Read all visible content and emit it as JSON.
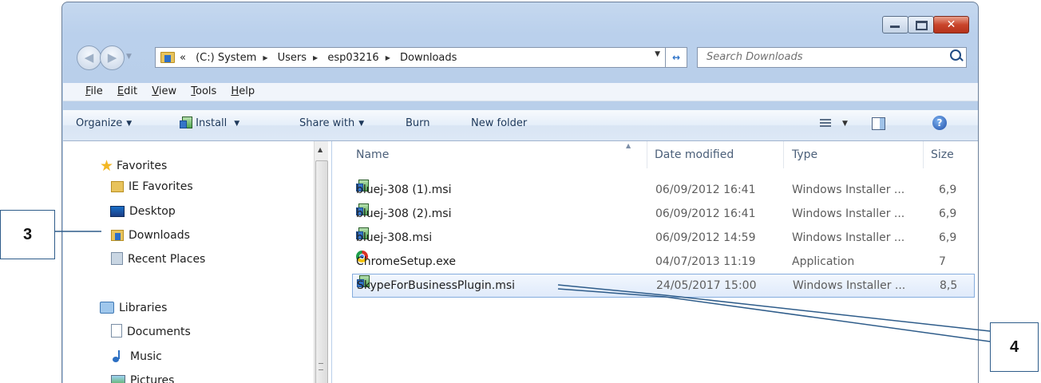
{
  "window": {
    "controls": {
      "minimize": "minimize",
      "maximize": "maximize",
      "close": "✕"
    }
  },
  "address_bar": {
    "prefix": "«",
    "crumbs": [
      "(C:) System",
      "Users",
      "esp03216",
      "Downloads"
    ],
    "search_placeholder": "Search Downloads"
  },
  "menu": [
    "File",
    "Edit",
    "View",
    "Tools",
    "Help"
  ],
  "menu_underline": [
    "F",
    "E",
    "V",
    "T",
    "H"
  ],
  "toolbar": {
    "organize": "Organize",
    "install": "Install",
    "share_with": "Share with",
    "burn": "Burn",
    "new_folder": "New folder"
  },
  "sidebar": {
    "favorites_label": "Favorites",
    "favorites": [
      "IE Favorites",
      "Desktop",
      "Downloads",
      "Recent Places"
    ],
    "libraries_label": "Libraries",
    "libraries": [
      "Documents",
      "Music",
      "Pictures"
    ]
  },
  "columns": [
    "Name",
    "Date modified",
    "Type",
    "Size"
  ],
  "files": [
    {
      "name": "bluej-308 (1).msi",
      "date": "06/09/2012 16:41",
      "type": "Windows Installer ...",
      "size": "6,9",
      "icon": "msi-icon"
    },
    {
      "name": "bluej-308 (2).msi",
      "date": "06/09/2012 16:41",
      "type": "Windows Installer ...",
      "size": "6,9",
      "icon": "msi-icon"
    },
    {
      "name": "bluej-308.msi",
      "date": "06/09/2012 14:59",
      "type": "Windows Installer ...",
      "size": "6,9",
      "icon": "msi-icon"
    },
    {
      "name": "ChromeSetup.exe",
      "date": "04/07/2013 11:19",
      "type": "Application",
      "size": "7",
      "icon": "chrome-icon"
    },
    {
      "name": "SkypeForBusinessPlugin.msi",
      "date": "24/05/2017 15:00",
      "type": "Windows Installer ...",
      "size": "8,5",
      "icon": "msi-icon",
      "selected": true
    }
  ],
  "callouts": {
    "left": "3",
    "right": "4"
  },
  "colors": {
    "selection": "#dfeafa",
    "callout_border": "#2e5c8a",
    "chrome": "#bad0ec"
  }
}
